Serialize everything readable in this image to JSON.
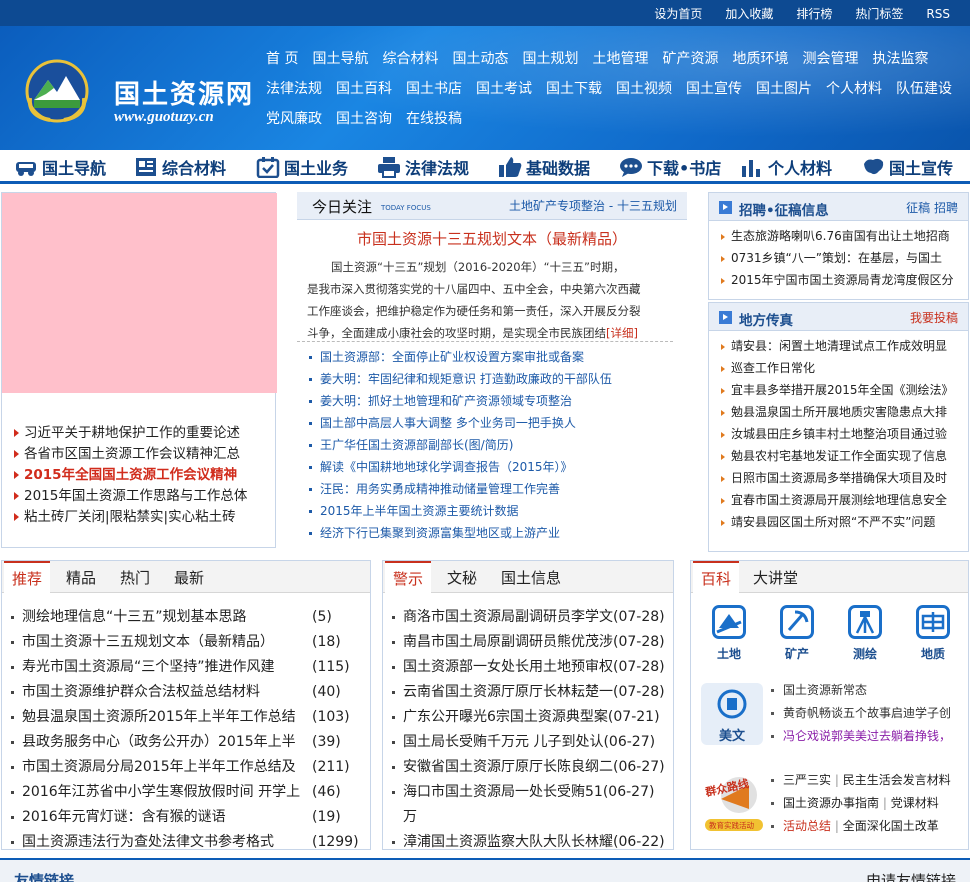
{
  "toplinks": [
    "设为首页",
    "加入收藏",
    "排行榜",
    "热门标签",
    "RSS"
  ],
  "logo": {
    "text": "国土资源网",
    "url": "www.guotuzy.cn"
  },
  "nav": {
    "row1": [
      "首 页",
      "国土导航",
      "综合材料",
      "国土动态",
      "国土规划",
      "土地管理",
      "矿产资源",
      "地质环境",
      "测会管理",
      "执法监察"
    ],
    "row2": [
      "法律法规",
      "国土百科",
      "国土书店",
      "国土考试",
      "国土下载",
      "国土视频",
      "国土宣传",
      "国土图片",
      "个人材料",
      "队伍建设"
    ],
    "row3": [
      "党风廉政",
      "国土咨询",
      "在线投稿"
    ]
  },
  "categories": [
    "国土导航",
    "综合材料",
    "国土业务",
    "法律法规",
    "基础数据",
    "下载•书店",
    "个人材料",
    "国土宣传"
  ],
  "left_list": [
    {
      "text": "习近平关于耕地保护工作的重要论述",
      "hot": false
    },
    {
      "text": "各省市区国土资源工作会议精神汇总",
      "hot": false
    },
    {
      "text": "2015年全国国土资源工作会议精神",
      "hot": true
    },
    {
      "text": "2015年国土资源工作思路与工作总体",
      "hot": false
    },
    {
      "text": "粘土砖厂关闭|限粘禁实|实心粘土砖",
      "hot": false
    }
  ],
  "focus": {
    "title": "今日关注",
    "title_en": "TODAY FOCUS",
    "link1": "土地矿产专项整治",
    "sep": "-",
    "link2": "十三五规划",
    "headline": "市国土资源十三五规划文本（最新精品）",
    "para_lines": [
      "国土资源“十三五”规划（2016-2020年）“十三五”时期，",
      "是我市深入贯彻落实党的十八届四中、五中全会，中央第六次西藏",
      "工作座谈会，把维护稳定作为硬任务和第一责任，深入开展反分裂",
      "斗争，全面建成小康社会的攻坚时期，是实现全市民族团结"
    ],
    "more": "[详细]",
    "list": [
      "国土资源部：全面停止矿业权设置方案审批或备案",
      "姜大明：牢固纪律和规矩意识 打造勤政廉政的干部队伍",
      "姜大明：抓好土地管理和矿产资源领域专项整治",
      "国土部中高层人事大调整 多个业务司一把手换人",
      "王广华任国土资源部副部长(图/简历)",
      "解读《中国耕地地球化学调查报告（2015年）》",
      "汪民：用务实勇成精神推动储量管理工作完善",
      "2015年上半年国土资源主要统计数据",
      "经济下行已集聚到资源富集型地区或上游产业"
    ]
  },
  "recruit": {
    "title": "招聘•征稿信息",
    "right": "征稿 招聘",
    "items": [
      "生态旅游略喇叭6.76亩国有出让土地招商",
      "0731乡镇“八一”策划：在基层，与国土",
      "2015年宁国市国土资源局青龙湾度假区分"
    ]
  },
  "local": {
    "title": "地方传真",
    "right": "我要投稿",
    "items": [
      "靖安县：闲置土地清理试点工作成效明显",
      "巡查工作日常化",
      "宜丰县多举措开展2015年全国《测绘法》",
      "勉县温泉国土所开展地质灾害隐患点大排",
      "汝城县田庄乡镇丰村土地整治项目通过验",
      "勉县农村宅基地发证工作全面实现了信息",
      "日照市国土资源局多举措确保大项目及时",
      "宜春市国土资源局开展测绘地理信息安全",
      "靖安县园区国土所对照“不严不实”问题"
    ]
  },
  "tab1": {
    "tabs": [
      "推荐",
      "精品",
      "热门",
      "最新"
    ],
    "rows": [
      {
        "t": "测绘地理信息“十三五”规划基本思路",
        "n": "(5)"
      },
      {
        "t": "市国土资源十三五规划文本（最新精品）",
        "n": "(18)"
      },
      {
        "t": "寿光市国土资源局“三个坚持”推进作风建",
        "n": "(115)"
      },
      {
        "t": "市国土资源维护群众合法权益总结材料",
        "n": "(40)"
      },
      {
        "t": "勉县温泉国土资源所2015年上半年工作总结",
        "n": "(103)"
      },
      {
        "t": "县政务服务中心（政务公开办）2015年上半",
        "n": "(39)"
      },
      {
        "t": "市国土资源局分局2015年上半年工作总结及",
        "n": "(211)"
      },
      {
        "t": "2016年江苏省中小学生寒假放假时间 开学上",
        "n": "(46)"
      },
      {
        "t": "2016年元宵灯谜：含有猴的谜语",
        "n": "(19)"
      },
      {
        "t": "国土资源违法行为查处法律文书参考格式",
        "n": "(1299)"
      }
    ]
  },
  "tab2": {
    "tabs": [
      "警示",
      "文秘",
      "国土信息"
    ],
    "rows": [
      {
        "t": "商洛市国土资源局副调研员李学文",
        "d": "(07-28)"
      },
      {
        "t": "南昌市国土局原副调研员熊优茂涉",
        "d": "(07-28)"
      },
      {
        "t": "国土资源部一女处长用土地预审权",
        "d": "(07-28)"
      },
      {
        "t": "云南省国土资源厅原厅长林耘楚一",
        "d": "(07-28)"
      },
      {
        "t": "广东公开曝光6宗国土资源典型案",
        "d": "(07-21)"
      },
      {
        "t": "国土局长受贿千万元 儿子到处认",
        "d": "(06-27)"
      },
      {
        "t": "安徽省国土资源厅原厅长陈良纲二",
        "d": "(06-27)"
      },
      {
        "t": "海口市国土资源局一处长受贿51",
        "d": "(06-27)"
      },
      {
        "t": "万",
        "d": ""
      },
      {
        "t": "漳浦国土资源监察大队大队长林耀",
        "d": "(06-22)"
      }
    ]
  },
  "tab3": {
    "tabs": [
      "百科",
      "大讲堂"
    ],
    "icons": [
      "土地",
      "矿产",
      "测绘",
      "地质"
    ],
    "meiwen": "美文",
    "meiwen_items": [
      {
        "t": "国土资源新常态",
        "c": "#333333"
      },
      {
        "t": "黄奇帆畅谈五个故事启迪学子创",
        "c": "#333333"
      },
      {
        "t": "冯仑戏说郭美美过去躺着挣钱，",
        "c": "#8a1ea8"
      }
    ],
    "act_items": [
      {
        "a": "三严三实",
        "b": "民主生活会发言材料",
        "red": false
      },
      {
        "a": "国土资源办事指南",
        "b": "党课材料",
        "red": false
      },
      {
        "a": "活动总结",
        "b": "全面深化国土改革",
        "red": true
      }
    ],
    "act_label": "群众路线",
    "act_sub": "教育实践活动"
  },
  "footer": {
    "left": "友情链接",
    "right": "申请友情链接"
  },
  "colors": {
    "brand_blue": "#0d5cb6",
    "accent_red": "#c8301d",
    "link_blue": "#1d5aa8"
  }
}
